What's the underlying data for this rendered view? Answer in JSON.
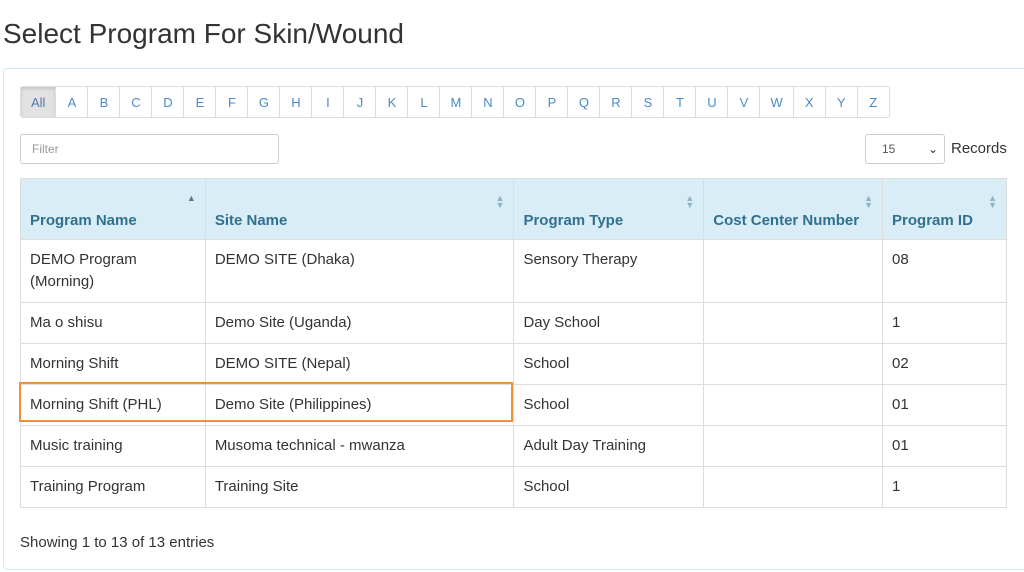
{
  "title": "Select Program For Skin/Wound",
  "alphabet": [
    "All",
    "A",
    "B",
    "C",
    "D",
    "E",
    "F",
    "G",
    "H",
    "I",
    "J",
    "K",
    "L",
    "M",
    "N",
    "O",
    "P",
    "Q",
    "R",
    "S",
    "T",
    "U",
    "V",
    "W",
    "X",
    "Y",
    "Z"
  ],
  "alphabet_selected": "All",
  "filter": {
    "placeholder": "Filter",
    "value": ""
  },
  "records": {
    "selected": "15",
    "label": "Records"
  },
  "columns": [
    "Program Name",
    "Site Name",
    "Program Type",
    "Cost Center Number",
    "Program ID"
  ],
  "sorted_column": "Program Name",
  "rows": [
    [
      "DEMO Program (Morning)",
      "DEMO SITE (Dhaka)",
      "Sensory Therapy",
      "",
      "08"
    ],
    [
      "Ma o shisu",
      "Demo Site (Uganda)",
      "Day School",
      "",
      "1"
    ],
    [
      "Morning Shift",
      "DEMO SITE (Nepal)",
      "School",
      "",
      "02"
    ],
    [
      "Morning Shift (PHL)",
      "Demo Site (Philippines)",
      "School",
      "",
      "01"
    ],
    [
      "Music training",
      "Musoma technical - mwanza",
      "Adult Day Training",
      "",
      "01"
    ],
    [
      "Training Program",
      "Training Site",
      "School",
      "",
      "1"
    ]
  ],
  "highlighted_row": 3,
  "colors": {
    "header_bg": "#d9edf7",
    "header_text": "#31708f",
    "highlight": "#f0903a",
    "link": "#4a8ac9"
  },
  "footer": {
    "info": "Showing 1 to 13 of 13 entries"
  }
}
